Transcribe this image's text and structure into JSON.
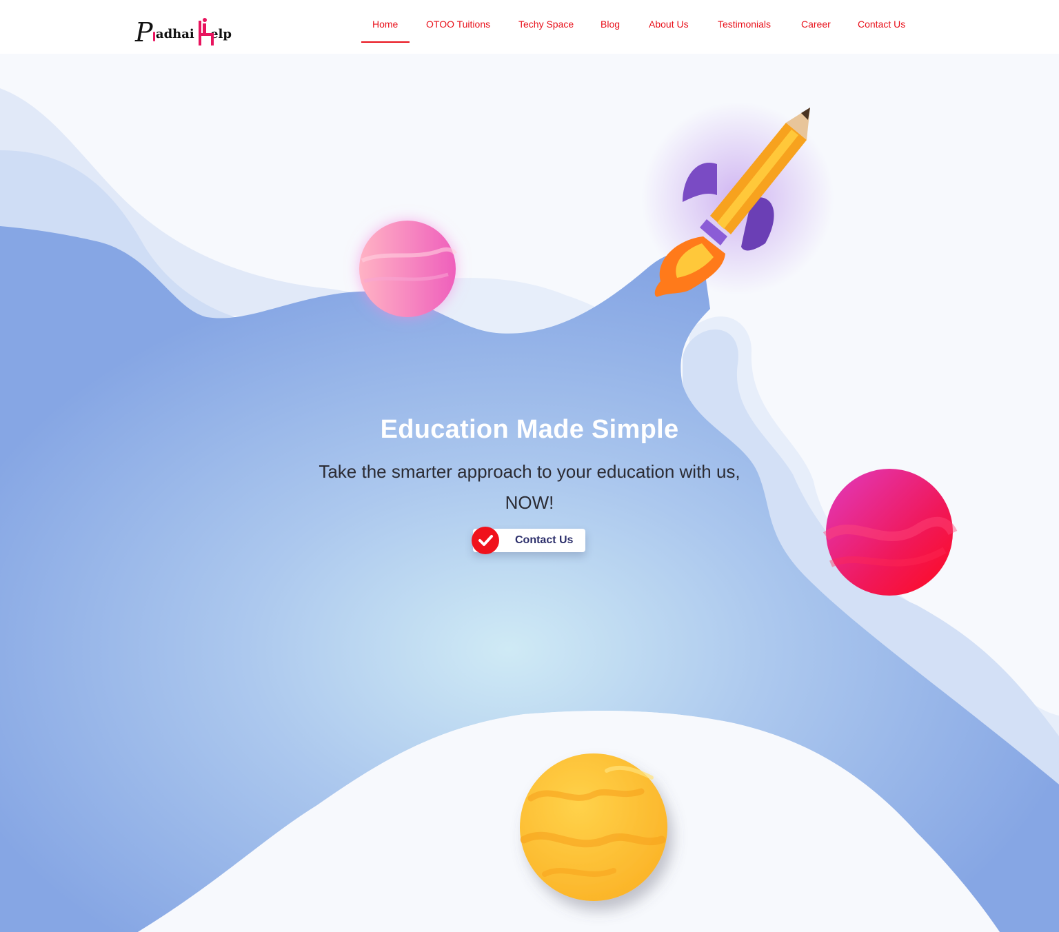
{
  "brand": {
    "logo_text_first": "adhai",
    "logo_text_second": "elp",
    "logo_alt": "Padhai Help"
  },
  "nav": {
    "items": [
      {
        "label": "Home",
        "active": true
      },
      {
        "label": "OTOO Tuitions",
        "active": false
      },
      {
        "label": "Techy Space",
        "active": false
      },
      {
        "label": "Blog",
        "active": false
      },
      {
        "label": "About Us",
        "active": false
      },
      {
        "label": "Testimonials",
        "active": false
      },
      {
        "label": "Career",
        "active": false
      },
      {
        "label": "Contact Us",
        "active": false
      }
    ]
  },
  "hero": {
    "title": "Education Made Simple",
    "subtitle": "Take the smarter approach to your education with us, NOW!",
    "cta_label": "Contact Us",
    "cta_icon": "check-circle-icon"
  },
  "colors": {
    "nav_text": "#e8101a",
    "accent_red": "#f0121c",
    "cta_text": "#2c2f6b",
    "hero_blue": "#8aa8e6",
    "brand_pink": "#e8145e"
  },
  "illustrations": [
    "pencil-rocket-icon",
    "pink-planet-icon",
    "magenta-planet-icon",
    "yellow-planet-icon"
  ]
}
